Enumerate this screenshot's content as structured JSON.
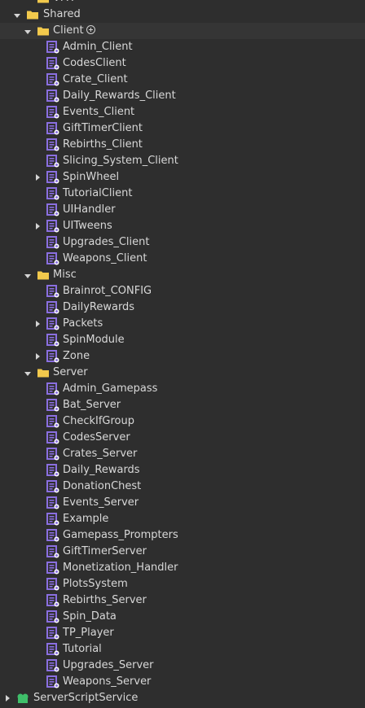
{
  "explorer": {
    "rows": [
      {
        "label": "VFX",
        "icon": "folder-icon",
        "level": 2,
        "arrow": "none"
      },
      {
        "label": "Shared",
        "icon": "folder-icon",
        "level": 1,
        "arrow": "down"
      },
      {
        "label": "Client",
        "icon": "folder-icon",
        "level": 2,
        "arrow": "down",
        "selected": true,
        "add_button": true
      },
      {
        "label": "Admin_Client",
        "icon": "local-script-icon",
        "level": 3,
        "arrow": "none"
      },
      {
        "label": "CodesClient",
        "icon": "local-script-icon",
        "level": 3,
        "arrow": "none"
      },
      {
        "label": "Crate_Client",
        "icon": "local-script-icon",
        "level": 3,
        "arrow": "none"
      },
      {
        "label": "Daily_Rewards_Client",
        "icon": "local-script-icon",
        "level": 3,
        "arrow": "none"
      },
      {
        "label": "Events_Client",
        "icon": "local-script-icon",
        "level": 3,
        "arrow": "none"
      },
      {
        "label": "GiftTimerClient",
        "icon": "local-script-icon",
        "level": 3,
        "arrow": "none"
      },
      {
        "label": "Rebirths_Client",
        "icon": "local-script-icon",
        "level": 3,
        "arrow": "none"
      },
      {
        "label": "Slicing_System_Client",
        "icon": "local-script-icon",
        "level": 3,
        "arrow": "none"
      },
      {
        "label": "SpinWheel",
        "icon": "local-script-icon",
        "level": 3,
        "arrow": "right"
      },
      {
        "label": "TutorialClient",
        "icon": "local-script-icon",
        "level": 3,
        "arrow": "none"
      },
      {
        "label": "UIHandler",
        "icon": "local-script-icon",
        "level": 3,
        "arrow": "none"
      },
      {
        "label": "UITweens",
        "icon": "local-script-icon",
        "level": 3,
        "arrow": "right"
      },
      {
        "label": "Upgrades_Client",
        "icon": "local-script-icon",
        "level": 3,
        "arrow": "none"
      },
      {
        "label": "Weapons_Client",
        "icon": "local-script-icon",
        "level": 3,
        "arrow": "none"
      },
      {
        "label": "Misc",
        "icon": "folder-icon",
        "level": 2,
        "arrow": "down"
      },
      {
        "label": "Brainrot_CONFIG",
        "icon": "local-script-icon",
        "level": 3,
        "arrow": "none"
      },
      {
        "label": "DailyRewards",
        "icon": "local-script-icon",
        "level": 3,
        "arrow": "none"
      },
      {
        "label": "Packets",
        "icon": "local-script-icon",
        "level": 3,
        "arrow": "right"
      },
      {
        "label": "SpinModule",
        "icon": "local-script-icon",
        "level": 3,
        "arrow": "none"
      },
      {
        "label": "Zone",
        "icon": "local-script-icon",
        "level": 3,
        "arrow": "right"
      },
      {
        "label": "Server",
        "icon": "folder-icon",
        "level": 2,
        "arrow": "down"
      },
      {
        "label": "Admin_Gamepass",
        "icon": "local-script-icon",
        "level": 3,
        "arrow": "none"
      },
      {
        "label": "Bat_Server",
        "icon": "local-script-icon",
        "level": 3,
        "arrow": "none"
      },
      {
        "label": "CheckIfGroup",
        "icon": "local-script-icon",
        "level": 3,
        "arrow": "none"
      },
      {
        "label": "CodesServer",
        "icon": "local-script-icon",
        "level": 3,
        "arrow": "none"
      },
      {
        "label": "Crates_Server",
        "icon": "local-script-icon",
        "level": 3,
        "arrow": "none"
      },
      {
        "label": "Daily_Rewards",
        "icon": "local-script-icon",
        "level": 3,
        "arrow": "none"
      },
      {
        "label": "DonationChest",
        "icon": "local-script-icon",
        "level": 3,
        "arrow": "none"
      },
      {
        "label": "Events_Server",
        "icon": "local-script-icon",
        "level": 3,
        "arrow": "none"
      },
      {
        "label": "Example",
        "icon": "local-script-icon",
        "level": 3,
        "arrow": "none"
      },
      {
        "label": "Gamepass_Prompters",
        "icon": "local-script-icon",
        "level": 3,
        "arrow": "none"
      },
      {
        "label": "GiftTimerServer",
        "icon": "local-script-icon",
        "level": 3,
        "arrow": "none"
      },
      {
        "label": "Monetization_Handler",
        "icon": "local-script-icon",
        "level": 3,
        "arrow": "none"
      },
      {
        "label": "PlotsSystem",
        "icon": "local-script-icon",
        "level": 3,
        "arrow": "none"
      },
      {
        "label": "Rebirths_Server",
        "icon": "local-script-icon",
        "level": 3,
        "arrow": "none"
      },
      {
        "label": "Spin_Data",
        "icon": "local-script-icon",
        "level": 3,
        "arrow": "none"
      },
      {
        "label": "TP_Player",
        "icon": "local-script-icon",
        "level": 3,
        "arrow": "none"
      },
      {
        "label": "Tutorial",
        "icon": "local-script-icon",
        "level": 3,
        "arrow": "none"
      },
      {
        "label": "Upgrades_Server",
        "icon": "local-script-icon",
        "level": 3,
        "arrow": "none"
      },
      {
        "label": "Weapons_Server",
        "icon": "local-script-icon",
        "level": 3,
        "arrow": "none"
      },
      {
        "label": "ServerScriptService",
        "icon": "server-script-service-icon",
        "level": 0,
        "arrow": "right"
      }
    ]
  },
  "colors": {
    "background": "#2e2e2e",
    "selected_row": "#353535",
    "folder": "#f2c94c",
    "script": "#8a6fe0",
    "service_green": "#3fbf6a"
  }
}
